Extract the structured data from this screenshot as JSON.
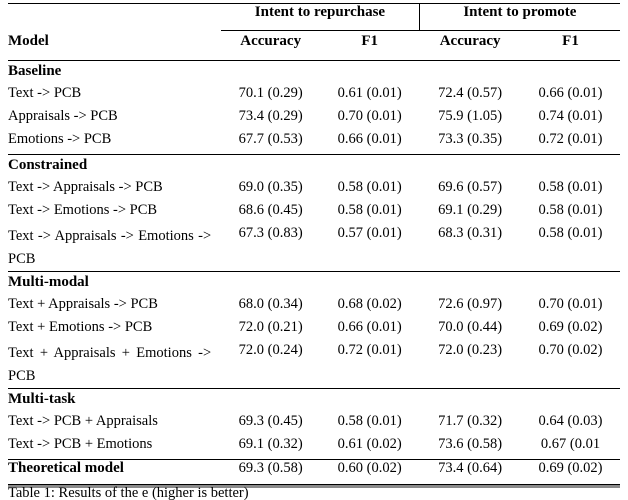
{
  "table": {
    "groups": [
      {
        "label": "Intent to repurchase"
      },
      {
        "label": "Intent to promote"
      }
    ],
    "columns": {
      "model": "Model",
      "accuracy_1": "Accuracy",
      "f1_1": "F1",
      "accuracy_2": "Accuracy",
      "f1_2": "F1"
    },
    "sections": [
      {
        "title": "Baseline",
        "rows": [
          {
            "model": "Text -> PCB",
            "acc1": "70.1 (0.29)",
            "f1_1": "0.61 (0.01)",
            "acc2": "72.4 (0.57)",
            "f1_2": "0.66 (0.01)"
          },
          {
            "model": "Appraisals -> PCB",
            "acc1": "73.4 (0.29)",
            "f1_1": "0.70 (0.01)",
            "acc2": "75.9 (1.05)",
            "f1_2": "0.74 (0.01)"
          },
          {
            "model": "Emotions -> PCB",
            "acc1": "67.7 (0.53)",
            "f1_1": "0.66 (0.01)",
            "acc2": "73.3 (0.35)",
            "f1_2": "0.72 (0.01)"
          }
        ]
      },
      {
        "title": "Constrained",
        "rows": [
          {
            "model": "Text -> Appraisals -> PCB",
            "acc1": "69.0 (0.35)",
            "f1_1": "0.58 (0.01)",
            "acc2": "69.6 (0.57)",
            "f1_2": "0.58 (0.01)"
          },
          {
            "model": "Text -> Emotions -> PCB",
            "acc1": "68.6 (0.45)",
            "f1_1": "0.58 (0.01)",
            "acc2": "69.1 (0.29)",
            "f1_2": "0.58 (0.01)"
          },
          {
            "model": "Text -> Appraisals -> Emotions -> PCB",
            "wrapped": true,
            "acc1": "67.3 (0.83)",
            "f1_1": "0.57 (0.01)",
            "acc2": "68.3 (0.31)",
            "f1_2": "0.58 (0.01)"
          }
        ]
      },
      {
        "title": "Multi-modal",
        "rows": [
          {
            "model": "Text + Appraisals -> PCB",
            "acc1": "68.0 (0.34)",
            "f1_1": "0.68 (0.02)",
            "acc2": "72.6 (0.97)",
            "f1_2": "0.70 (0.01)"
          },
          {
            "model": "Text + Emotions -> PCB",
            "acc1": "72.0 (0.21)",
            "f1_1": "0.66 (0.01)",
            "acc2": "70.0 (0.44)",
            "f1_2": "0.69 (0.02)"
          },
          {
            "model": "Text + Appraisals + Emotions -> PCB",
            "wrapped": true,
            "acc1": "72.0 (0.24)",
            "f1_1": "0.72 (0.01)",
            "acc2": "72.0 (0.23)",
            "f1_2": "0.70 (0.02)"
          }
        ]
      },
      {
        "title": "Multi-task",
        "rows": [
          {
            "model": "Text -> PCB + Appraisals",
            "acc1": "69.3 (0.45)",
            "f1_1": "0.58 (0.01)",
            "acc2": "71.7 (0.32)",
            "f1_2": "0.64 (0.03)"
          },
          {
            "model": "Text -> PCB + Emotions",
            "acc1": "69.1 (0.32)",
            "f1_1": "0.61 (0.02)",
            "acc2": "73.6 (0.58)",
            "f1_2": "0.67 (0.01"
          }
        ]
      }
    ],
    "final_row": {
      "model": "Theoretical model",
      "acc1": "69.3 (0.58)",
      "f1_1": "0.60 (0.02)",
      "acc2": "73.4 (0.64)",
      "f1_2": "0.69 (0.02)"
    }
  },
  "caption": "Table 1: Results of the e (higher is better)"
}
